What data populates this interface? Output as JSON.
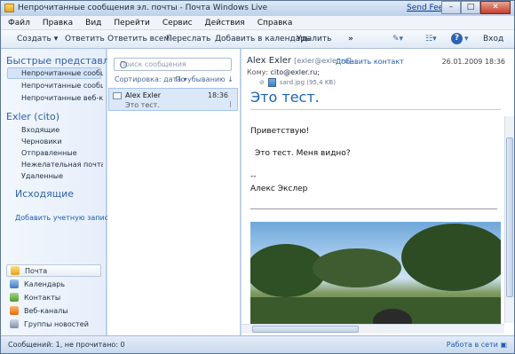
{
  "window": {
    "title": "Непрочитанные сообщения эл. почты - Почта Windows Live",
    "feedback": "Send Feedback",
    "minimize": "–",
    "maximize": "□",
    "close": "✕"
  },
  "menu": [
    "Файл",
    "Правка",
    "Вид",
    "Перейти",
    "Сервис",
    "Действия",
    "Справка"
  ],
  "toolbar": {
    "create": "Создать",
    "reply": "Ответить",
    "reply_all": "Ответить всем",
    "forward": "Переслать",
    "add_calendar": "Добавить в календарь",
    "delete": "Удалить",
    "more": "»",
    "signin": "Вход"
  },
  "sidebar": {
    "quick_title": "Быстрые представл...",
    "quick_items": [
      "Непрочитанные сообщ...",
      "Непрочитанные сообщ...",
      "Непрочитанные веб-ка..."
    ],
    "account_title": "Exler (cito)",
    "folders": [
      "Входящие",
      "Черновики",
      "Отправленные",
      "Нежелательная почта",
      "Удаленные"
    ],
    "outgoing_title": "Исходящие",
    "add_account": "Добавить учетную запись ..."
  },
  "nav": [
    "Почта",
    "Календарь",
    "Контакты",
    "Веб-каналы",
    "Группы новостей"
  ],
  "list": {
    "search_placeholder": "Поиск сообщения",
    "sort_label": "Сортировка: дата ▾",
    "order_label": "По убыванию ↓",
    "messages": [
      {
        "from": "Alex Exler",
        "time": "18:36",
        "subject": "Это тест."
      }
    ]
  },
  "reading": {
    "from_name": "Alex Exler",
    "from_email": "[exler@exler.ru]",
    "add_contact": "Добавить контакт",
    "date": "26.01.2009 18:36",
    "to_label": "Кому:",
    "to_value": "cito@exler.ru;",
    "attachment": "sard.jpg (95,4 KB)",
    "subject": "Это тест.",
    "greeting": "Приветствую!",
    "body": "Это тест. Меня видно?",
    "sig_dash": "--",
    "signature": "Алекс Экслер"
  },
  "status": {
    "counts": "Сообщений: 1, не прочитано: 0",
    "online": "Работа в сети"
  }
}
